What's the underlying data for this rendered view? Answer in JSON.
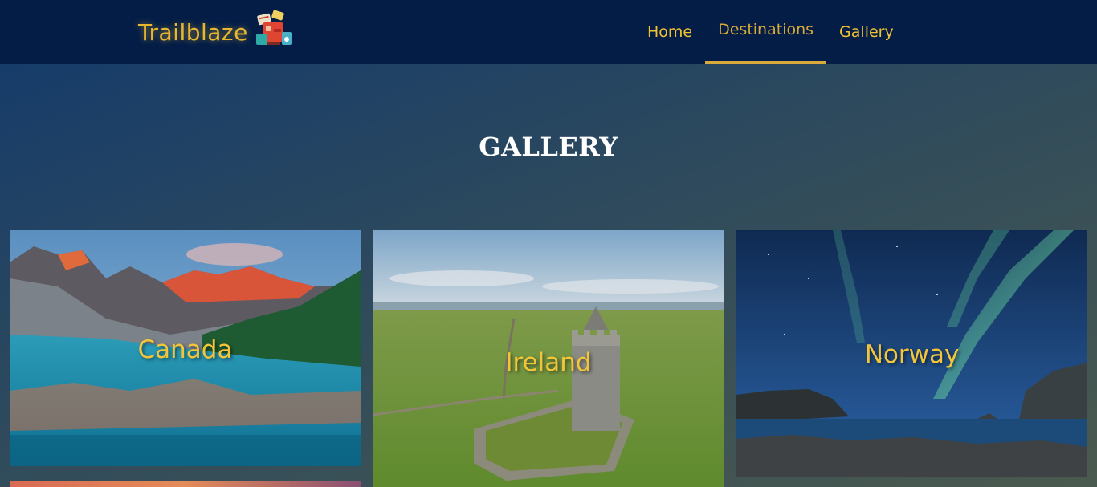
{
  "header": {
    "logo_text": "Trailblaze",
    "logo_icon": "luggage-icon",
    "nav": [
      {
        "label": "Home",
        "active": false
      },
      {
        "label": "Destinations",
        "active": true
      },
      {
        "label": "Gallery",
        "active": false
      }
    ]
  },
  "main": {
    "title": "GALLERY",
    "cards": [
      {
        "label": "Canada",
        "image": "mountain-lake-image"
      },
      {
        "label": "Ireland",
        "image": "castle-tower-image"
      },
      {
        "label": "Norway",
        "image": "aurora-coast-image"
      },
      {
        "label": "",
        "image": "sunset-image"
      }
    ]
  },
  "colors": {
    "navbar_bg": "#031d47",
    "accent": "#f1c232",
    "title_text": "#ffffff"
  }
}
